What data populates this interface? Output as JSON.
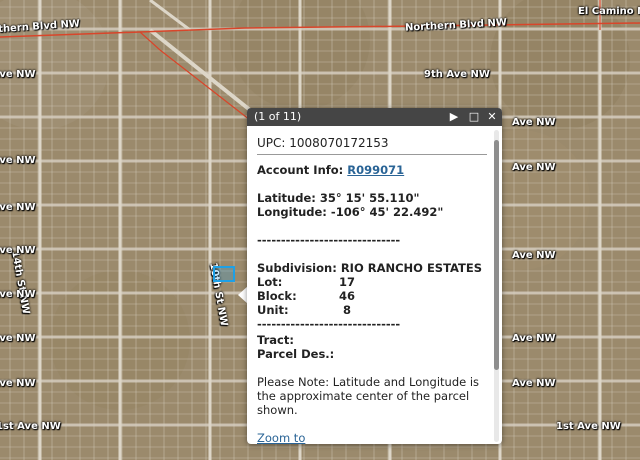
{
  "map": {
    "street_labels": [
      {
        "text": "Northern Blvd NW"
      },
      {
        "text": "Northern Blvd NW"
      },
      {
        "text": "El Camino NE"
      },
      {
        "text": "9th Ave NW"
      },
      {
        "text": "Ave NW"
      },
      {
        "text": "Ave NW"
      },
      {
        "text": "Ave NW"
      },
      {
        "text": "14th St NW"
      },
      {
        "text": "Ave NW"
      },
      {
        "text": "Ave NW"
      },
      {
        "text": "10th St NW"
      },
      {
        "text": "Ave NW"
      },
      {
        "text": "Ave NW"
      },
      {
        "text": "1st Ave NW"
      },
      {
        "text": "Ave NW"
      },
      {
        "text": "1st Ave NW"
      },
      {
        "text": "Ave NW"
      },
      {
        "text": "Ave NW"
      },
      {
        "text": "Ave NW"
      },
      {
        "text": "Ave NW"
      }
    ],
    "highlight_color": "#1ea0e6"
  },
  "popup": {
    "counter": "(1 of 11)",
    "buttons": {
      "next": "▶",
      "maximize": "□",
      "close": "✕"
    },
    "upc_label": "UPC:",
    "upc_value": "1008070172153",
    "account_label": "Account Info:",
    "account_value": "R099071",
    "latitude_label": "Latitude:",
    "latitude_value": "35° 15' 55.110\"",
    "longitude_label": "Longitude:",
    "longitude_value": "-106° 45' 22.492\"",
    "dashes": "------------------------------",
    "subdivision_label": "Subdivision:",
    "subdivision_value": "RIO RANCHO ESTATES",
    "lot_label": "Lot:",
    "lot_value": "17",
    "block_label": "Block:",
    "block_value": "46",
    "unit_label": "Unit:",
    "unit_value": "8",
    "tract_label": "Tract:",
    "parcel_label": "Parcel Des.:",
    "note": "Please Note: Latitude and Longitude is the approximate center of the parcel shown.",
    "zoom_link": "Zoom to"
  }
}
